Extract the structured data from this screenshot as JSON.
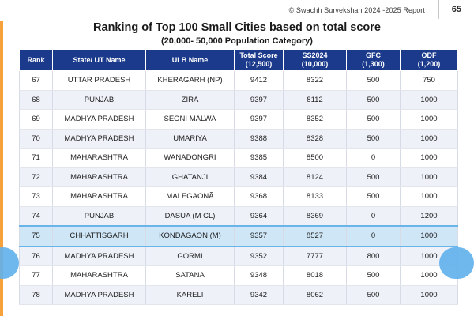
{
  "header": {
    "report_label": "© Swachh Survekshan 2024 -2025 Report",
    "page_number": "65"
  },
  "title": "Ranking of Top 100 Small Cities based on total score",
  "subtitle": "(20,000- 50,000 Population Category)",
  "table": {
    "columns": [
      {
        "line1": "Rank",
        "line2": ""
      },
      {
        "line1": "State/ UT Name",
        "line2": ""
      },
      {
        "line1": "ULB Name",
        "line2": ""
      },
      {
        "line1": "Total Score",
        "line2": "(12,500)"
      },
      {
        "line1": "SS2024",
        "line2": "(10,000)"
      },
      {
        "line1": "GFC",
        "line2": "(1,300)"
      },
      {
        "line1": "ODF",
        "line2": "(1,200)"
      }
    ],
    "rows": [
      {
        "rank": "67",
        "state": "UTTAR PRADESH",
        "ulb": "KHERAGARH (NP)",
        "total": "9412",
        "ss2024": "8322",
        "gfc": "500",
        "odf": "750"
      },
      {
        "rank": "68",
        "state": "PUNJAB",
        "ulb": "ZIRA",
        "total": "9397",
        "ss2024": "8112",
        "gfc": "500",
        "odf": "1000"
      },
      {
        "rank": "69",
        "state": "MADHYA PRADESH",
        "ulb": "SEONI MALWA",
        "total": "9397",
        "ss2024": "8352",
        "gfc": "500",
        "odf": "1000"
      },
      {
        "rank": "70",
        "state": "MADHYA PRADESH",
        "ulb": "UMARIYA",
        "total": "9388",
        "ss2024": "8328",
        "gfc": "500",
        "odf": "1000"
      },
      {
        "rank": "71",
        "state": "MAHARASHTRA",
        "ulb": "WANADONGRI",
        "total": "9385",
        "ss2024": "8500",
        "gfc": "0",
        "odf": "1000"
      },
      {
        "rank": "72",
        "state": "MAHARASHTRA",
        "ulb": "GHATANJI",
        "total": "9384",
        "ss2024": "8124",
        "gfc": "500",
        "odf": "1000"
      },
      {
        "rank": "73",
        "state": "MAHARASHTRA",
        "ulb": "MALEGAONÃ",
        "total": "9368",
        "ss2024": "8133",
        "gfc": "500",
        "odf": "1000"
      },
      {
        "rank": "74",
        "state": "PUNJAB",
        "ulb": "DASUA (M CL)",
        "total": "9364",
        "ss2024": "8369",
        "gfc": "0",
        "odf": "1200"
      },
      {
        "rank": "75",
        "state": "CHHATTISGARH",
        "ulb": "KONDAGAON (M)",
        "total": "9357",
        "ss2024": "8527",
        "gfc": "0",
        "odf": "1000"
      },
      {
        "rank": "76",
        "state": "MADHYA PRADESH",
        "ulb": "GORMI",
        "total": "9352",
        "ss2024": "7777",
        "gfc": "800",
        "odf": "1000"
      },
      {
        "rank": "77",
        "state": "MAHARASHTRA",
        "ulb": "SATANA",
        "total": "9348",
        "ss2024": "8018",
        "gfc": "500",
        "odf": "1000"
      },
      {
        "rank": "78",
        "state": "MADHYA PRADESH",
        "ulb": "KARELI",
        "total": "9342",
        "ss2024": "8062",
        "gfc": "500",
        "odf": "1000"
      }
    ],
    "highlighted_rank": "75"
  },
  "colors": {
    "header_bg": "#1b3a8c",
    "highlight_bg": "#cfe6f7",
    "highlight_marker": "#5fb0ec",
    "accent": "#f6a23c"
  }
}
